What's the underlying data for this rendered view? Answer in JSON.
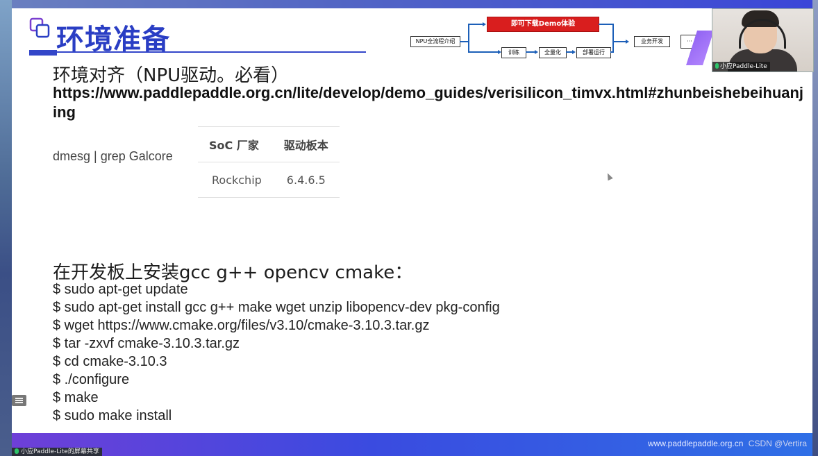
{
  "slide": {
    "title": "环境准备",
    "subheading": "环境对齐（NPU驱动。必看）",
    "link": "https://www.paddlepaddle.org.cn/lite/develop/demo_guides/verisilicon_timvx.html#zhunbeishebeihuanjing",
    "dmesg": "dmesg | grep Galcore",
    "table": {
      "headers": [
        "SoC 厂家",
        "驱动板本"
      ],
      "rows": [
        [
          "Rockchip",
          "6.4.6.5"
        ]
      ]
    },
    "install_heading": "在开发板上安装gcc g++ opencv cmake：",
    "commands": [
      "$ sudo apt-get update",
      "$ sudo apt-get install gcc g++ make wget unzip libopencv-dev pkg-config",
      "$ wget https://www.cmake.org/files/v3.10/cmake-3.10.3.tar.gz",
      "$ tar -zxvf cmake-3.10.3.tar.gz",
      "$ cd cmake-3.10.3",
      "$ ./configure",
      "$ make",
      "$ sudo make install"
    ]
  },
  "flow": {
    "intro": "NPU全流程介绍",
    "demo": "即可下载Demo体验",
    "train": "训练",
    "quant": "全量化",
    "deploy": "部署运行",
    "business": "业务开发",
    "more": "···"
  },
  "webcam": {
    "name": "小应Paddle-Lite"
  },
  "footer": {
    "url": "www.paddlepaddle.org.cn",
    "watermark": "CSDN @Vertira",
    "share_label": "小应Paddle-Lite的屏幕共享"
  },
  "colors": {
    "title": "#2a3ec4",
    "demo_box": "#d91e1e",
    "flow_line": "#1c5fb8"
  }
}
